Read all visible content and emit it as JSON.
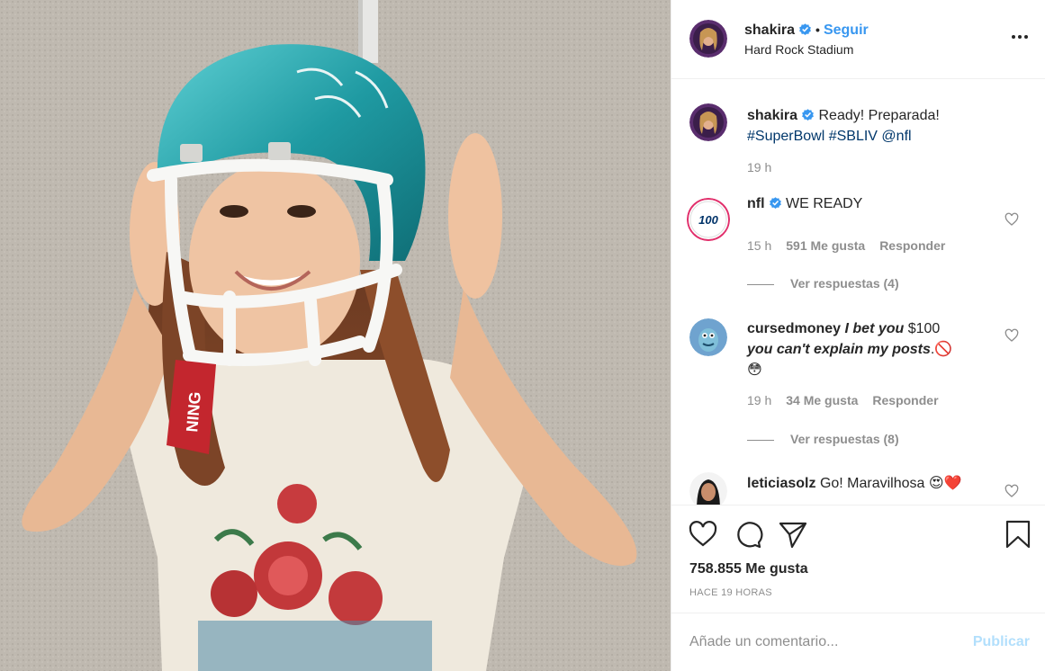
{
  "post": {
    "username": "shakira",
    "follow_label": "Seguir",
    "separator": "•",
    "location": "Hard Rock Stadium"
  },
  "caption": {
    "username": "shakira",
    "text": "Ready! Preparada!",
    "hashtags": "#SuperBowl #SBLIV @nfl",
    "time": "19 h"
  },
  "comments": [
    {
      "username": "nfl",
      "text": "WE READY",
      "time": "15 h",
      "likes": "591 Me gusta",
      "reply": "Responder",
      "view_replies": "Ver respuestas (4)",
      "avatar_text": "100"
    },
    {
      "username": "cursedmoney",
      "text_italic_1": "I bet you",
      "text_plain": " $100",
      "text_italic_2": "you can't explain my posts",
      "text_end": ".🚫",
      "emoji": "😳",
      "time": "19 h",
      "likes": "34 Me gusta",
      "reply": "Responder",
      "view_replies": "Ver respuestas (8)"
    },
    {
      "username": "leticiasolz",
      "text": "Go! Maravilhosa 😍❤️"
    }
  ],
  "actions": {
    "likes_count": "758.855 Me gusta",
    "timestamp": "HACE 19 HORAS"
  },
  "comment_box": {
    "placeholder": "Añade un comentario...",
    "publish_label": "Publicar"
  },
  "colors": {
    "accent": "#3897f0",
    "text": "#262626",
    "muted": "#8e8e8e",
    "publish_disabled": "#b2dffc",
    "helmet": "#2a9aa3"
  }
}
